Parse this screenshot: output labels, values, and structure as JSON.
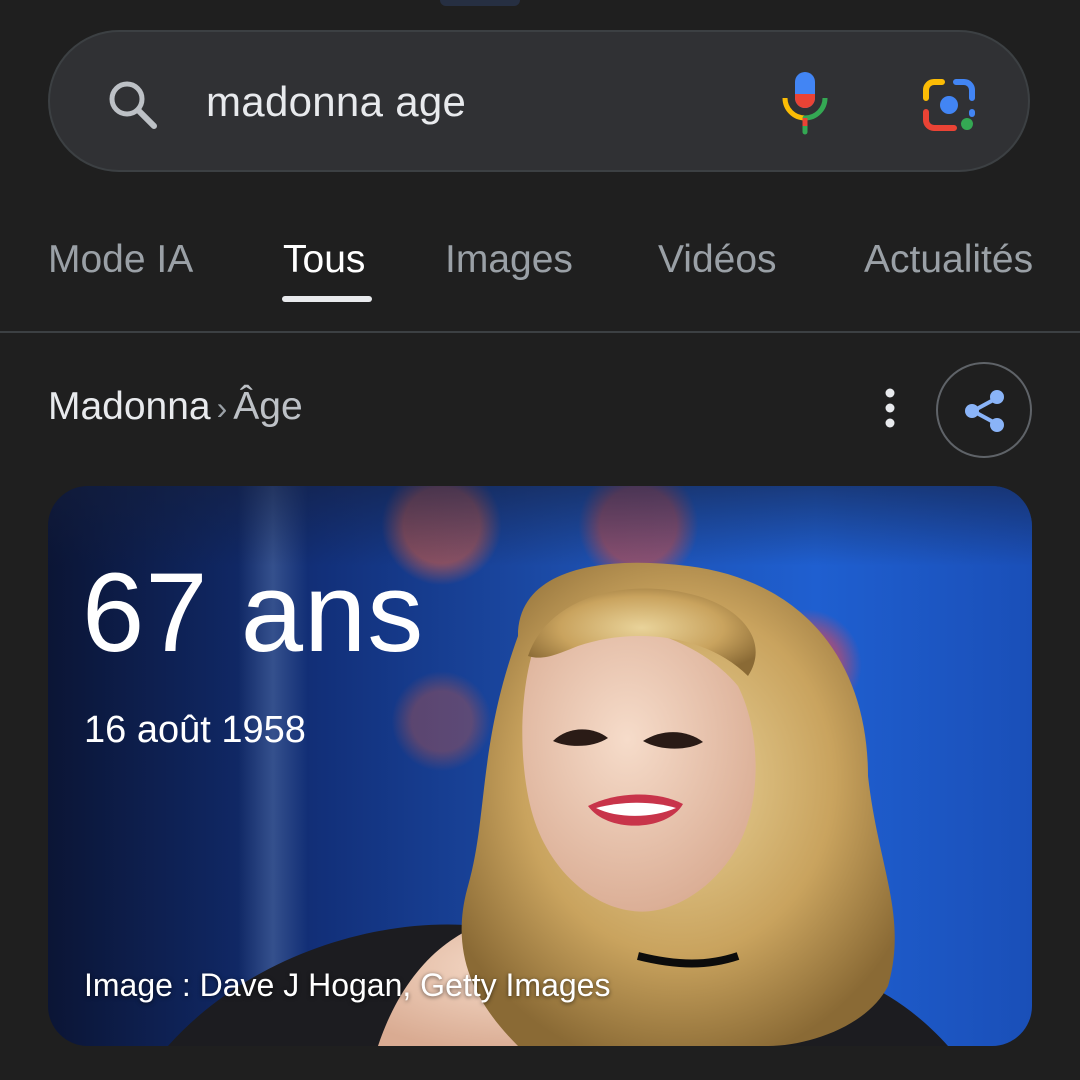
{
  "search": {
    "query": "madonna age"
  },
  "icons": {
    "search": "search-icon",
    "mic": "mic-icon",
    "lens": "google-lens-icon",
    "more": "more-vert-icon",
    "share": "share-icon"
  },
  "tabs": [
    {
      "label": "Mode IA",
      "active": false
    },
    {
      "label": "Tous",
      "active": true
    },
    {
      "label": "Images",
      "active": false
    },
    {
      "label": "Vidéos",
      "active": false
    },
    {
      "label": "Actualités",
      "active": false
    }
  ],
  "breadcrumb": {
    "entity": "Madonna",
    "separator": "›",
    "attribute": "Âge"
  },
  "answer_card": {
    "age": "67 ans",
    "birth_date": "16 août 1958",
    "image_credit": "Image : Dave J Hogan, Getty Images"
  },
  "colors": {
    "background": "#1f1f1f",
    "search_bar": "#303134",
    "share_blue": "#8ab4f8",
    "google_blue": "#4285f4",
    "google_red": "#ea4335",
    "google_yellow": "#fbbc05",
    "google_green": "#34a853"
  }
}
